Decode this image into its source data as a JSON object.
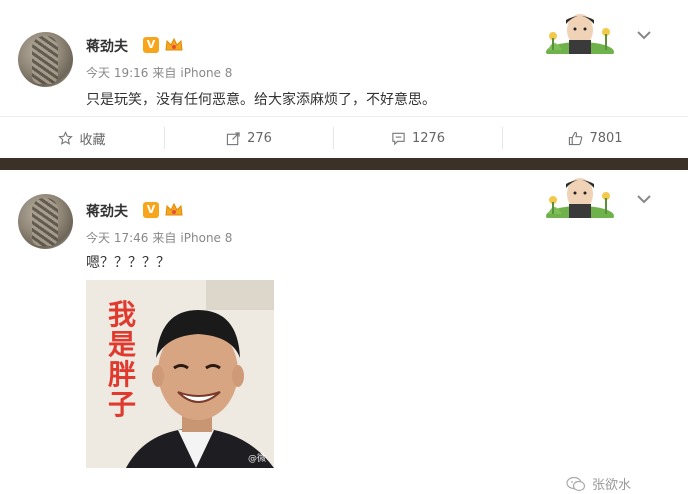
{
  "posts": [
    {
      "author": "蒋劲夫",
      "badge": "V",
      "time": "今天 19:16",
      "source_prefix": "来自",
      "source": "iPhone 8",
      "text": "只是玩笑，没有任何恶意。给大家添麻烦了，不好意思。",
      "actions": {
        "favorite": "收藏",
        "repost": "276",
        "comment": "1276",
        "like": "7801"
      }
    },
    {
      "author": "蒋劲夫",
      "badge": "V",
      "time": "今天 17:46",
      "source_prefix": "来自",
      "source": "iPhone 8",
      "text": "嗯？？？？？",
      "image_caption": "我是胖子",
      "image_watermark": "@微"
    }
  ],
  "watermark": {
    "text": "张欲水",
    "icon": "wechat-icon"
  },
  "colors": {
    "badge": "#f7a51c",
    "divider": "#3b3127",
    "meta": "#888888",
    "caption_red": "#e03a2e"
  }
}
